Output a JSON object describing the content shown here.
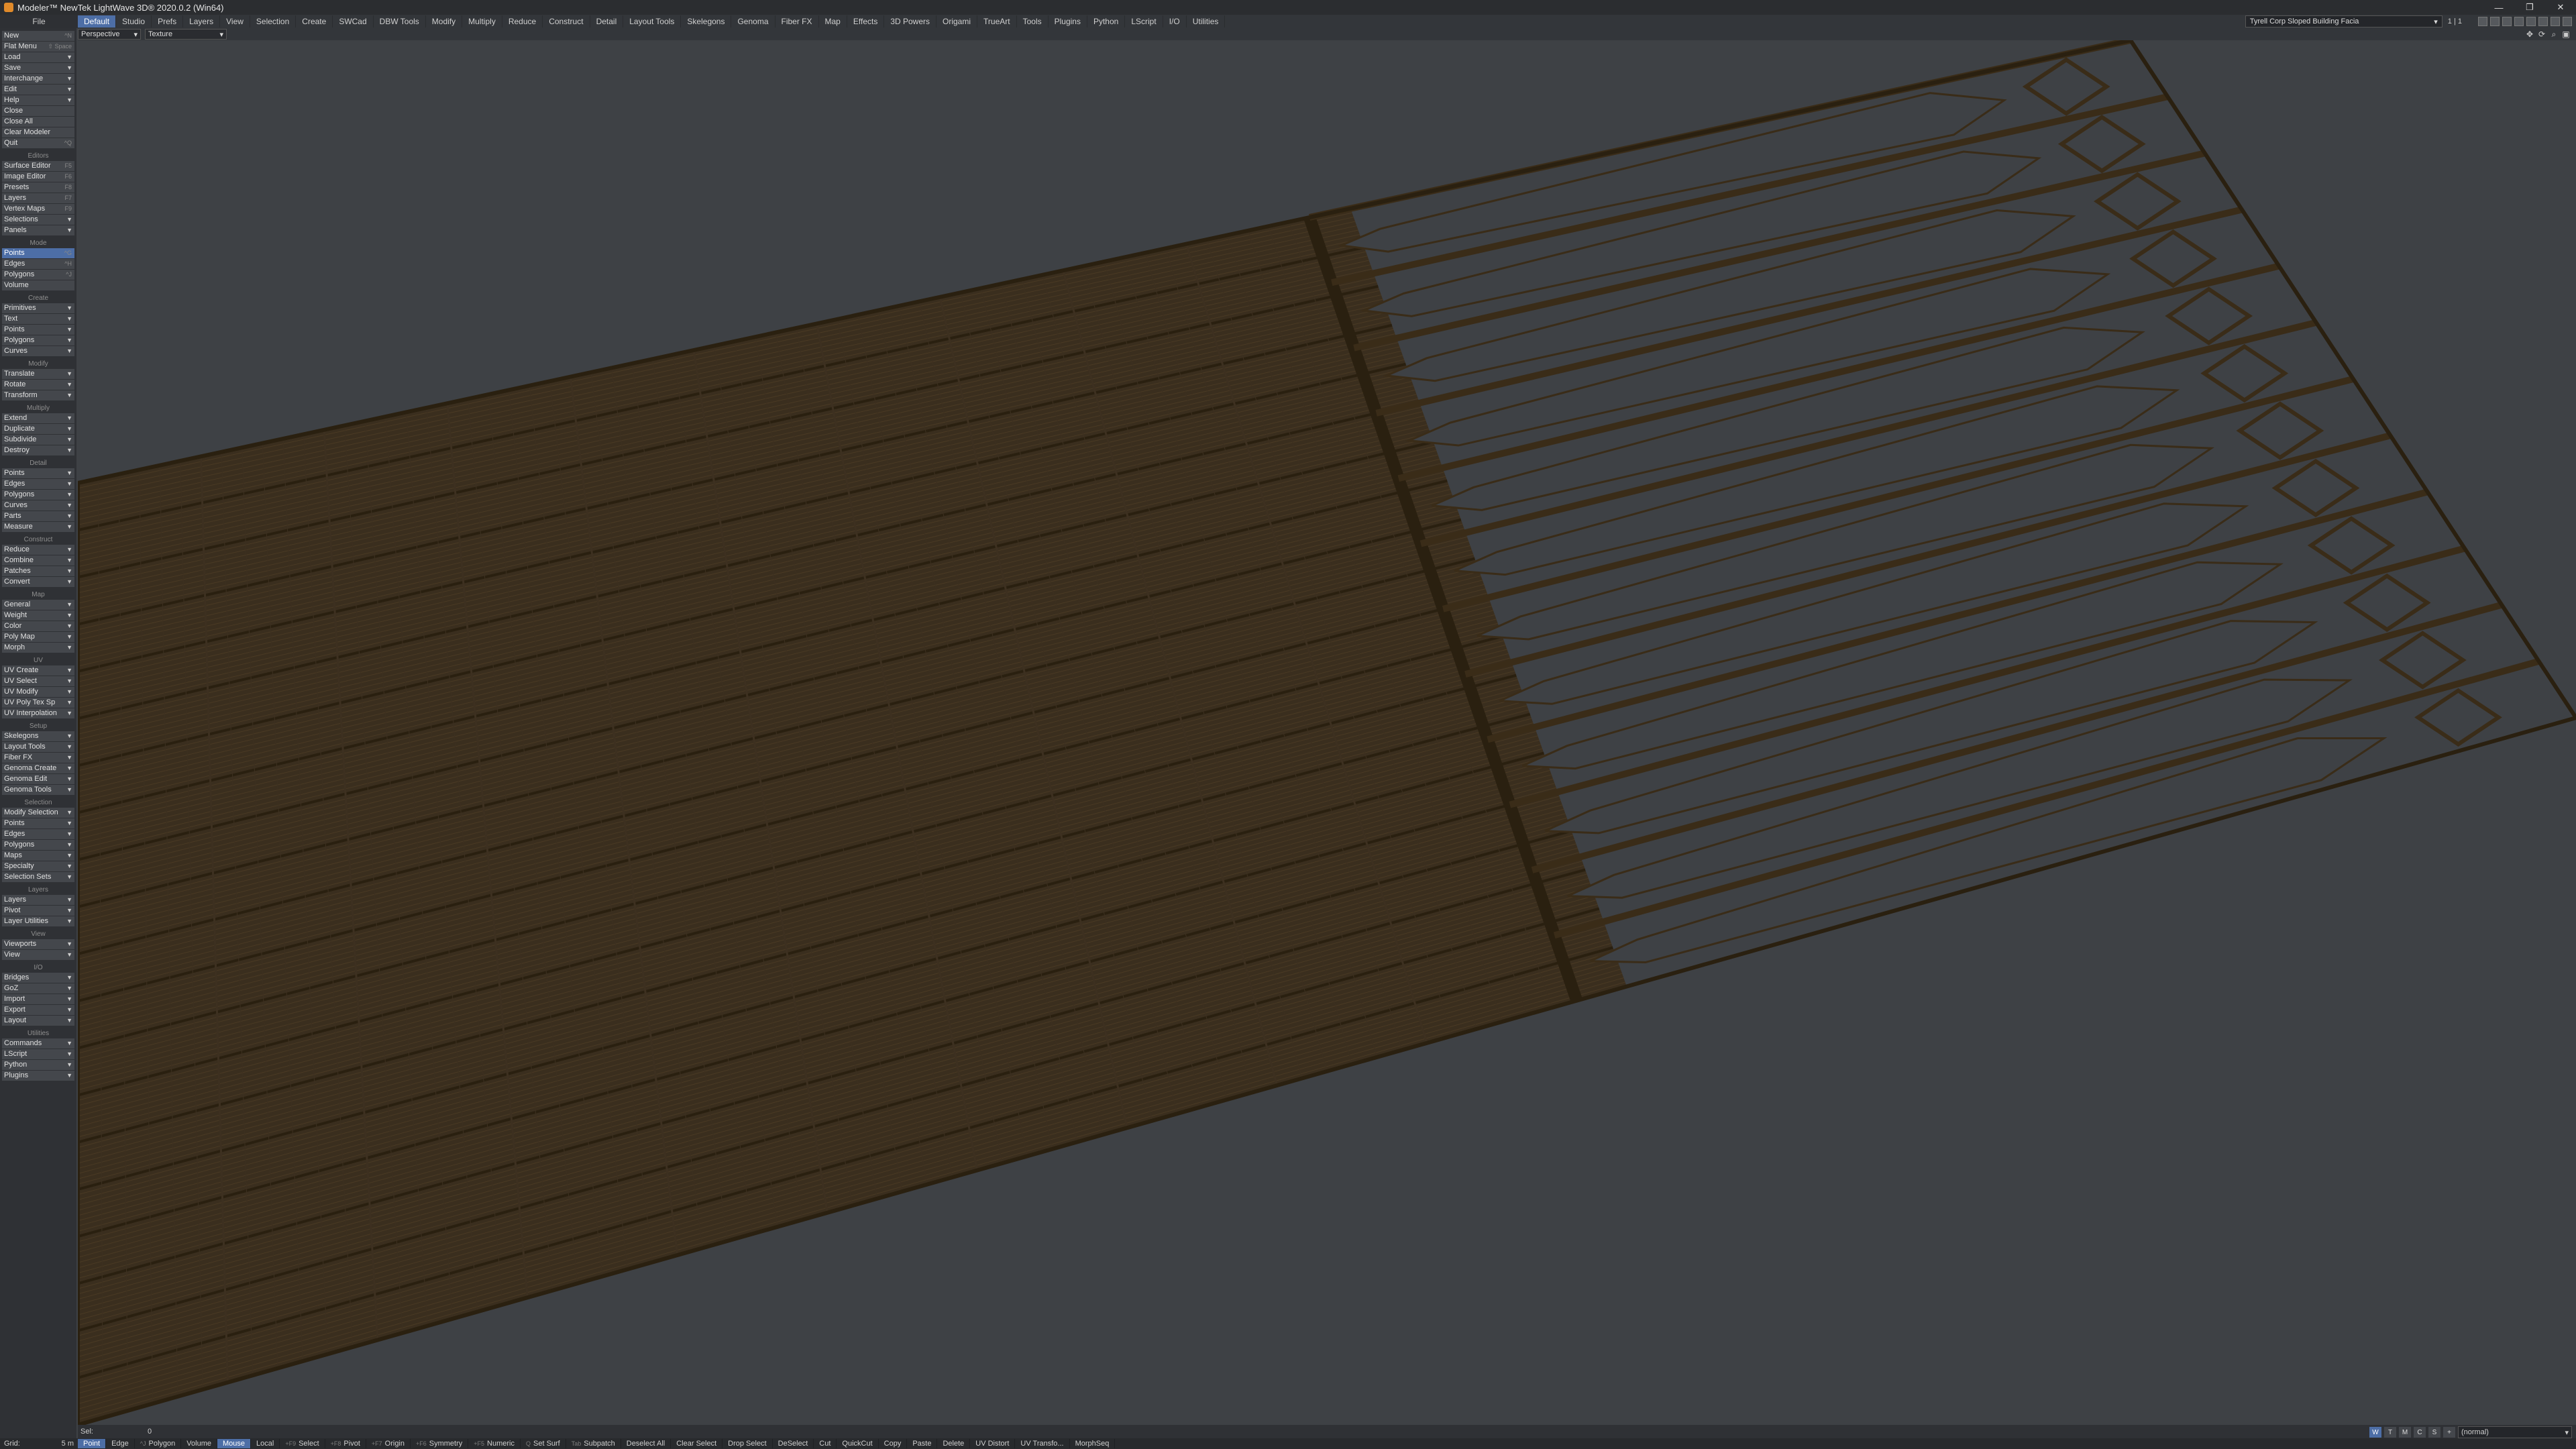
{
  "window": {
    "title": "Modeler™ NewTek LightWave 3D® 2020.0.2 (Win64)",
    "controls": [
      "—",
      "❐",
      "✕"
    ]
  },
  "tabs": {
    "file": "File",
    "items": [
      "Default",
      "Studio",
      "Prefs",
      "Layers",
      "View",
      "Selection",
      "Create",
      "SWCad",
      "DBW Tools",
      "Modify",
      "Multiply",
      "Reduce",
      "Construct",
      "Detail",
      "Layout Tools",
      "Skelegons",
      "Genoma",
      "Fiber FX",
      "Map",
      "Effects",
      "3D Powers",
      "Origami",
      "TrueArt",
      "Tools",
      "Plugins",
      "Python",
      "LScript",
      "I/O",
      "Utilities"
    ],
    "active": "Default",
    "scene": "Tyrell Corp Sloped Building Facia",
    "layer_info": "1 | 1"
  },
  "viewport_header": {
    "view_mode": "Perspective",
    "render_mode": "Texture",
    "icons": [
      "move-icon",
      "rotate-icon",
      "zoom-icon",
      "maximize-icon"
    ]
  },
  "sidebar": {
    "file_items": [
      {
        "label": "New",
        "key": "^N"
      },
      {
        "label": "Flat Menu",
        "key": "⇧ Space"
      },
      {
        "label": "Load",
        "chev": true
      },
      {
        "label": "Save",
        "chev": true
      },
      {
        "label": "Interchange",
        "chev": true
      },
      {
        "label": "Edit",
        "chev": true
      },
      {
        "label": "Help",
        "chev": true
      },
      {
        "label": "Close",
        "key": ""
      },
      {
        "label": "Close All",
        "key": ""
      },
      {
        "label": "Clear Modeler",
        "key": ""
      },
      {
        "label": "Quit",
        "key": "^Q"
      }
    ],
    "sections": [
      {
        "title": "Editors",
        "items": [
          {
            "label": "Surface Editor",
            "key": "F5"
          },
          {
            "label": "Image Editor",
            "key": "F6"
          },
          {
            "label": "Presets",
            "key": "F8"
          },
          {
            "label": "Layers",
            "key": "F7"
          },
          {
            "label": "Vertex Maps",
            "key": "F9"
          },
          {
            "label": "Selections",
            "chev": true
          },
          {
            "label": "Panels",
            "chev": true
          }
        ]
      },
      {
        "title": "Mode",
        "items": [
          {
            "label": "Points",
            "key": "^G",
            "active": true
          },
          {
            "label": "Edges",
            "key": "^H"
          },
          {
            "label": "Polygons",
            "key": "^J"
          },
          {
            "label": "Volume",
            "key": ""
          }
        ]
      },
      {
        "title": "Create",
        "items": [
          {
            "label": "Primitives",
            "chev": true
          },
          {
            "label": "Text",
            "chev": true
          },
          {
            "label": "Points",
            "chev": true
          },
          {
            "label": "Polygons",
            "chev": true
          },
          {
            "label": "Curves",
            "chev": true
          }
        ]
      },
      {
        "title": "Modify",
        "items": [
          {
            "label": "Translate",
            "chev": true
          },
          {
            "label": "Rotate",
            "chev": true
          },
          {
            "label": "Transform",
            "chev": true
          }
        ]
      },
      {
        "title": "Multiply",
        "items": [
          {
            "label": "Extend",
            "chev": true
          },
          {
            "label": "Duplicate",
            "chev": true
          },
          {
            "label": "Subdivide",
            "chev": true
          },
          {
            "label": "Destroy",
            "chev": true
          }
        ]
      },
      {
        "title": "Detail",
        "items": [
          {
            "label": "Points",
            "chev": true
          },
          {
            "label": "Edges",
            "chev": true
          },
          {
            "label": "Polygons",
            "chev": true
          },
          {
            "label": "Curves",
            "chev": true
          },
          {
            "label": "Parts",
            "chev": true
          },
          {
            "label": "Measure",
            "chev": true
          }
        ]
      },
      {
        "title": "Construct",
        "items": [
          {
            "label": "Reduce",
            "chev": true
          },
          {
            "label": "Combine",
            "chev": true
          },
          {
            "label": "Patches",
            "chev": true
          },
          {
            "label": "Convert",
            "chev": true
          }
        ]
      },
      {
        "title": "Map",
        "items": [
          {
            "label": "General",
            "chev": true
          },
          {
            "label": "Weight",
            "chev": true
          },
          {
            "label": "Color",
            "chev": true
          },
          {
            "label": "Poly Map",
            "chev": true
          },
          {
            "label": "Morph",
            "chev": true
          }
        ]
      },
      {
        "title": "UV",
        "items": [
          {
            "label": "UV Create",
            "chev": true
          },
          {
            "label": "UV Select",
            "chev": true
          },
          {
            "label": "UV Modify",
            "chev": true
          },
          {
            "label": "UV Poly Tex Sp",
            "chev": true
          },
          {
            "label": "UV Interpolation",
            "chev": true
          }
        ]
      },
      {
        "title": "Setup",
        "items": [
          {
            "label": "Skelegons",
            "chev": true
          },
          {
            "label": "Layout Tools",
            "chev": true
          },
          {
            "label": "Fiber FX",
            "chev": true
          },
          {
            "label": "Genoma Create",
            "chev": true
          },
          {
            "label": "Genoma Edit",
            "chev": true
          },
          {
            "label": "Genoma Tools",
            "chev": true
          }
        ]
      },
      {
        "title": "Selection",
        "items": [
          {
            "label": "Modify Selection",
            "chev": true
          },
          {
            "label": "Points",
            "chev": true
          },
          {
            "label": "Edges",
            "chev": true
          },
          {
            "label": "Polygons",
            "chev": true
          },
          {
            "label": "Maps",
            "chev": true
          },
          {
            "label": "Specialty",
            "chev": true
          },
          {
            "label": "Selection Sets",
            "chev": true
          }
        ]
      },
      {
        "title": "Layers",
        "items": [
          {
            "label": "Layers",
            "chev": true
          },
          {
            "label": "Pivot",
            "chev": true
          },
          {
            "label": "Layer Utilities",
            "chev": true
          }
        ]
      },
      {
        "title": "View",
        "items": [
          {
            "label": "Viewports",
            "chev": true
          },
          {
            "label": "View",
            "chev": true
          }
        ]
      },
      {
        "title": "I/O",
        "items": [
          {
            "label": "Bridges",
            "chev": true
          },
          {
            "label": "GoZ",
            "chev": true
          },
          {
            "label": "Import",
            "chev": true
          },
          {
            "label": "Export",
            "chev": true
          },
          {
            "label": "Layout",
            "chev": true
          }
        ]
      },
      {
        "title": "Utilities",
        "items": [
          {
            "label": "Commands",
            "chev": true
          },
          {
            "label": "LScript",
            "chev": true
          },
          {
            "label": "Python",
            "chev": true
          },
          {
            "label": "Plugins",
            "chev": true
          }
        ]
      }
    ]
  },
  "status": {
    "sel_label": "Sel:",
    "sel_value": "0",
    "wtmcs": [
      "W",
      "T",
      "M",
      "C",
      "S",
      "+"
    ],
    "normal_mode": "(normal)"
  },
  "bottom": {
    "grid_label": "Grid:",
    "grid_value": "5 m",
    "buttons": [
      {
        "label": "Point",
        "active": true
      },
      {
        "label": "Edge"
      },
      {
        "label": "Polygon",
        "key": "^J"
      },
      {
        "label": "Volume"
      },
      {
        "label": "Mouse",
        "active": true
      },
      {
        "label": "Local"
      },
      {
        "label": "Select",
        "key": "+F9"
      },
      {
        "label": "Pivot",
        "key": "+F8"
      },
      {
        "label": "Origin",
        "key": "+F7"
      },
      {
        "label": "Symmetry",
        "key": "+F6"
      },
      {
        "label": "Numeric",
        "key": "+F5"
      },
      {
        "label": "Set Surf",
        "key": "Q"
      },
      {
        "label": "Subpatch",
        "key": "Tab"
      },
      {
        "label": "Deselect All"
      },
      {
        "label": "Clear Select"
      },
      {
        "label": "Drop Select"
      },
      {
        "label": "DeSelect"
      },
      {
        "label": "Cut"
      },
      {
        "label": "QuickCut"
      },
      {
        "label": "Copy"
      },
      {
        "label": "Paste"
      },
      {
        "label": "Delete"
      },
      {
        "label": "UV Distort"
      },
      {
        "label": "UV Transfo..."
      },
      {
        "label": "MorphSeq"
      }
    ]
  },
  "colors": {
    "wire": "#3a2c18",
    "wire_dark": "#2a2010",
    "viewport_bg": "#3e4145",
    "accent": "#4d6ea6"
  }
}
